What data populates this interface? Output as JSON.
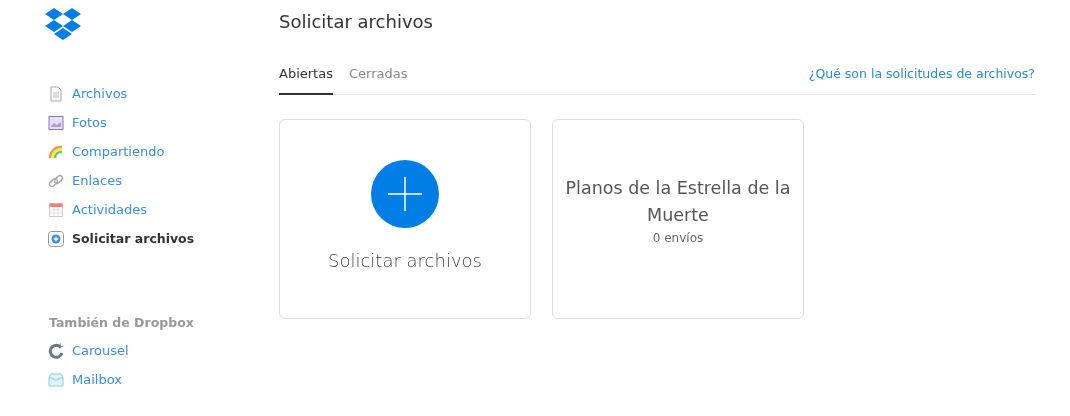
{
  "nav": [
    {
      "label": "Archivos",
      "kind": "file",
      "selected": false
    },
    {
      "label": "Fotos",
      "kind": "photos",
      "selected": false
    },
    {
      "label": "Compartiendo",
      "kind": "sharing",
      "selected": false
    },
    {
      "label": "Enlaces",
      "kind": "link",
      "selected": false
    },
    {
      "label": "Actividades",
      "kind": "calendar",
      "selected": false
    },
    {
      "label": "Solicitar archivos",
      "kind": "request",
      "selected": true
    }
  ],
  "also": {
    "heading": "También de Dropbox",
    "items": [
      {
        "label": "Carousel",
        "kind": "carousel"
      },
      {
        "label": "Mailbox",
        "kind": "mailbox"
      }
    ]
  },
  "page_title": "Solicitar archivos",
  "tabs": [
    {
      "label": "Abiertas",
      "selected": true
    },
    {
      "label": "Cerradas",
      "selected": false
    }
  ],
  "help_link": "¿Qué son la solicitudes de archivos?",
  "cards": [
    {
      "kind": "new",
      "title": "Solicitar archivos"
    },
    {
      "kind": "request",
      "title": "Planos de la Estrella de la Muerte",
      "count": "0 envíos"
    }
  ]
}
